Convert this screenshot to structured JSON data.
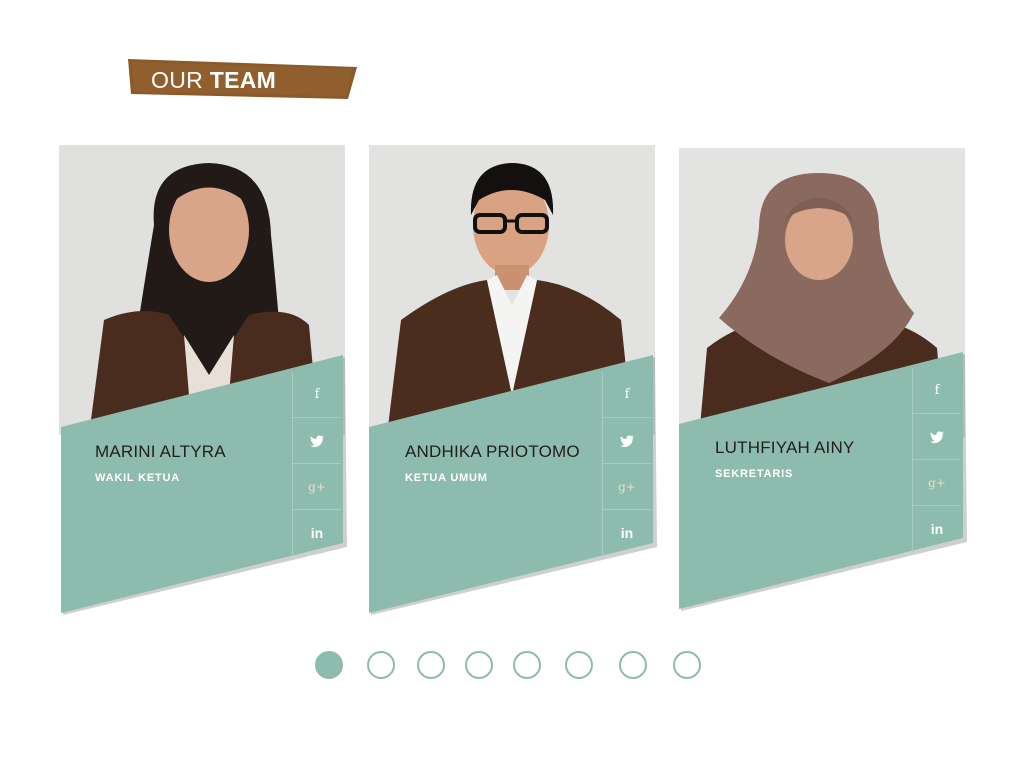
{
  "section": {
    "title_light": "OUR",
    "title_bold": "TEAM",
    "banner_color": "#8b5a2b"
  },
  "theme": {
    "panel_color": "#8dbbae",
    "name_color": "#1f1f1f",
    "role_color": "#ffffff"
  },
  "members": [
    {
      "name": "MARINI ALTYRA",
      "role": "WAKIL KETUA",
      "photo_icon": "portrait-long-hair",
      "social": [
        "f",
        "t",
        "g+",
        "in"
      ]
    },
    {
      "name": "ANDHIKA PRIOTOMO",
      "role": "KETUA UMUM",
      "photo_icon": "portrait-glasses",
      "social": [
        "f",
        "t",
        "g+",
        "in"
      ]
    },
    {
      "name": "LUTHFIYAH AINY",
      "role": "SEKRETARIS",
      "photo_icon": "portrait-hijab",
      "social": [
        "f",
        "t",
        "g+",
        "in"
      ]
    }
  ],
  "pagination": {
    "total": 8,
    "active_index": 0
  }
}
